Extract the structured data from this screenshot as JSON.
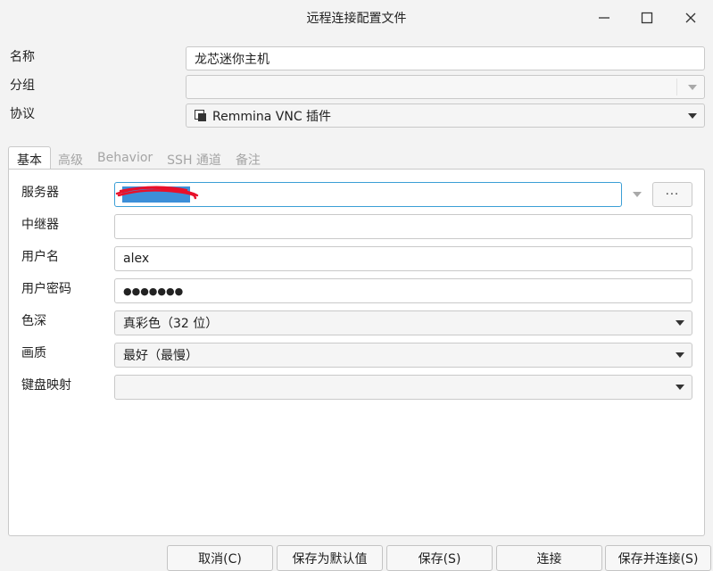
{
  "window": {
    "title": "远程连接配置文件",
    "minimize_icon": "minimize-icon",
    "maximize_icon": "maximize-icon",
    "close_icon": "close-icon"
  },
  "form": {
    "name_label": "名称",
    "name_value": "龙芯迷你主机",
    "group_label": "分组",
    "group_value": "",
    "protocol_label": "协议",
    "protocol_value": "Remmina VNC 插件",
    "protocol_icon": "plugin-windows-icon"
  },
  "tabs": [
    {
      "label": "基本",
      "active": true
    },
    {
      "label": "高级",
      "active": false
    },
    {
      "label": "Behavior",
      "active": false
    },
    {
      "label": "SSH 通道",
      "active": false
    },
    {
      "label": "备注",
      "active": false
    }
  ],
  "basic": {
    "server_label": "服务器",
    "server_value": "",
    "server_more_label": "···",
    "repeater_label": "中继器",
    "repeater_value": "",
    "username_label": "用户名",
    "username_value": "alex",
    "password_label": "用户密码",
    "password_value": "●●●●●●●",
    "color_depth_label": "色深",
    "color_depth_value": "真彩色（32 位）",
    "quality_label": "画质",
    "quality_value": "最好（最慢）",
    "keymap_label": "键盘映射",
    "keymap_value": ""
  },
  "buttons": {
    "cancel": "取消(C)",
    "save_default": "保存为默认值",
    "save": "保存(S)",
    "connect": "连接",
    "save_connect": "保存并连接(S)"
  },
  "colors": {
    "focus_border": "#3b9fd6",
    "selection": "#3c8fd8",
    "redaction_scribble": "#e8102a"
  }
}
